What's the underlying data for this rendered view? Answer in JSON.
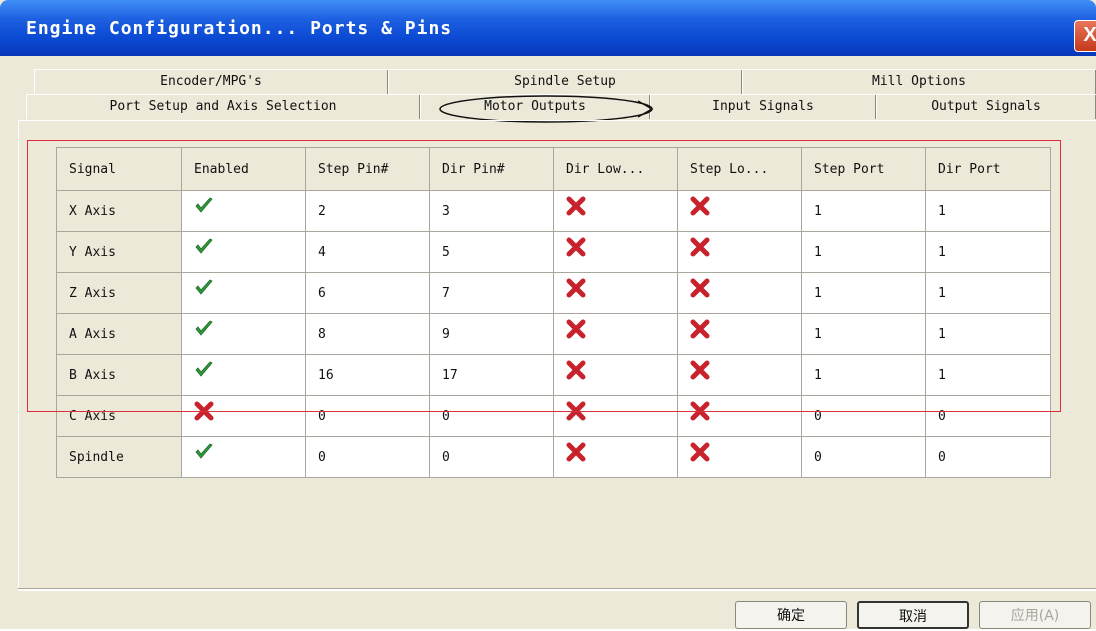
{
  "window": {
    "title": "Engine Configuration... Ports & Pins",
    "close_label": "X"
  },
  "tabs": {
    "row1": [
      "Encoder/MPG's",
      "Spindle Setup",
      "Mill Options"
    ],
    "row2": [
      "Port Setup and Axis Selection",
      "Motor Outputs",
      "Input Signals",
      "Output Signals"
    ],
    "active": "Motor Outputs"
  },
  "table": {
    "columns": [
      "Signal",
      "Enabled",
      "Step Pin#",
      "Dir Pin#",
      "Dir Low...",
      "Step Lo...",
      "Step Port",
      "Dir Port"
    ],
    "rows": [
      {
        "signal": "X Axis",
        "enabled": true,
        "step_pin": "2",
        "dir_pin": "3",
        "dir_low": false,
        "step_low": false,
        "step_port": "1",
        "dir_port": "1"
      },
      {
        "signal": "Y Axis",
        "enabled": true,
        "step_pin": "4",
        "dir_pin": "5",
        "dir_low": false,
        "step_low": false,
        "step_port": "1",
        "dir_port": "1"
      },
      {
        "signal": "Z Axis",
        "enabled": true,
        "step_pin": "6",
        "dir_pin": "7",
        "dir_low": false,
        "step_low": false,
        "step_port": "1",
        "dir_port": "1"
      },
      {
        "signal": "A Axis",
        "enabled": true,
        "step_pin": "8",
        "dir_pin": "9",
        "dir_low": false,
        "step_low": false,
        "step_port": "1",
        "dir_port": "1"
      },
      {
        "signal": "B Axis",
        "enabled": true,
        "step_pin": "16",
        "dir_pin": "17",
        "dir_low": false,
        "step_low": false,
        "step_port": "1",
        "dir_port": "1"
      },
      {
        "signal": "C Axis",
        "enabled": false,
        "step_pin": "0",
        "dir_pin": "0",
        "dir_low": false,
        "step_low": false,
        "step_port": "0",
        "dir_port": "0"
      },
      {
        "signal": "Spindle",
        "enabled": true,
        "step_pin": "0",
        "dir_pin": "0",
        "dir_low": false,
        "step_low": false,
        "step_port": "0",
        "dir_port": "0"
      }
    ]
  },
  "buttons": {
    "ok": "确定",
    "cancel": "取消",
    "apply": "应用(A)"
  },
  "colors": {
    "titlebar": "#0a48d2",
    "check": "#2e9b3a",
    "cross": "#c8232c",
    "highlight_box": "#d9303a"
  }
}
